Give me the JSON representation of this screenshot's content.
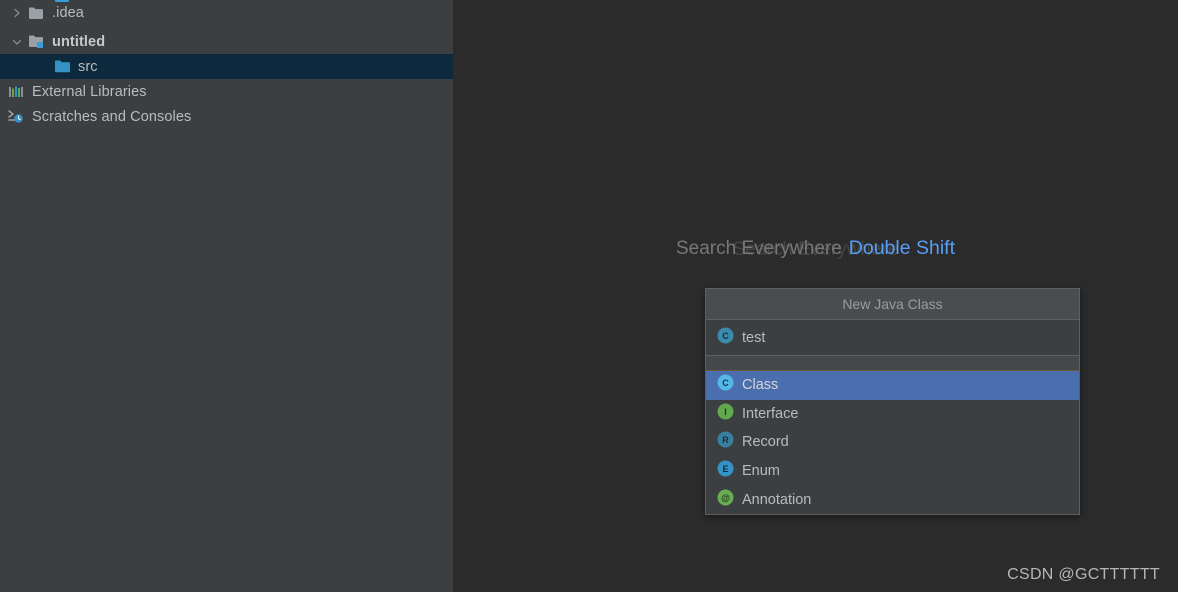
{
  "project_tree": {
    "partial_top_row": {
      "icon": "folder-blue-icon",
      "label": ""
    },
    "items": [
      {
        "label": ".idea",
        "icon": "folder-grey-icon",
        "twisty": "chevron-right-icon",
        "indent": 0,
        "selected": false,
        "bold": false
      },
      {
        "label": "untitled",
        "icon": "module-folder-icon",
        "twisty": "chevron-down-icon",
        "indent": 0,
        "selected": false,
        "bold": true
      },
      {
        "label": "src",
        "icon": "folder-source-icon",
        "twisty": "none",
        "indent": 2,
        "selected": true,
        "bold": false
      },
      {
        "label": "External Libraries",
        "icon": "libraries-bars-icon",
        "twisty": "none",
        "indent": 0,
        "selected": false,
        "bold": false
      },
      {
        "label": "Scratches and Consoles",
        "icon": "scratches-clock-icon",
        "twisty": "none",
        "indent": 0,
        "selected": false,
        "bold": false
      }
    ]
  },
  "editor": {
    "search_hint": {
      "label": "Search Everywhere",
      "shortcut": "Double Shift",
      "shortcut_color": "#589df6"
    }
  },
  "new_class_popup": {
    "title": "New Java Class",
    "name_field": {
      "value": "test",
      "placeholder": "",
      "icon": "class-c-icon"
    },
    "kinds": [
      {
        "label": "Class",
        "icon": "class-c-icon",
        "badge_letter": "C",
        "badge_color": "#3592c4",
        "selected": true
      },
      {
        "label": "Interface",
        "icon": "interface-i-icon",
        "badge_letter": "I",
        "badge_color": "#62a84f",
        "selected": false
      },
      {
        "label": "Record",
        "icon": "record-r-icon",
        "badge_letter": "R",
        "badge_color": "#3b7f9e",
        "selected": false
      },
      {
        "label": "Enum",
        "icon": "enum-e-icon",
        "badge_letter": "E",
        "badge_color": "#3592c4",
        "selected": false
      },
      {
        "label": "Annotation",
        "icon": "annotation-at-icon",
        "badge_letter": "@",
        "badge_color": "#62a84f",
        "selected": false
      }
    ],
    "selection_color": "#4b6eaf"
  },
  "watermark": {
    "text": "CSDN @GCTTTTTT"
  },
  "colors": {
    "panel_bg": "#3c3f41",
    "editor_bg": "#2b2b2b",
    "tree_selection": "#0d293e",
    "popup_bg": "#3c3f41",
    "popup_header": "#4a4d4f",
    "popup_border": "#5e6060",
    "text": "#bbbbbb",
    "accent_blue": "#589df6"
  }
}
